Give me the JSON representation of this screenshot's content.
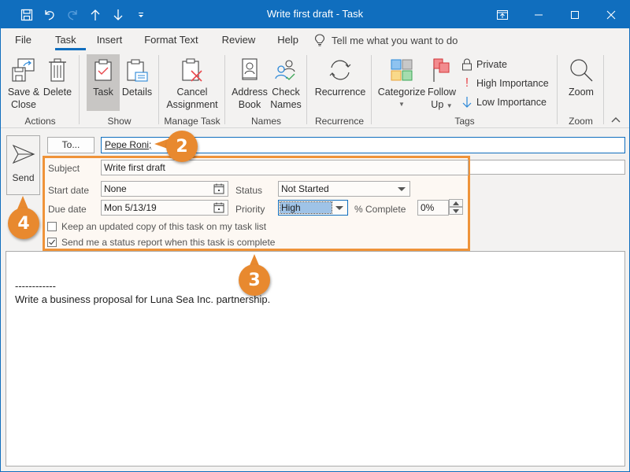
{
  "window": {
    "title": "Write first draft  -  Task",
    "accent_color": "#106ebe",
    "quick_access": [
      {
        "icon": "save-icon",
        "label": "Save"
      },
      {
        "icon": "undo-icon",
        "label": "Undo"
      },
      {
        "icon": "redo-icon",
        "label": "Redo"
      },
      {
        "icon": "arrow-up-icon",
        "label": "Previous Item"
      },
      {
        "icon": "arrow-down-icon",
        "label": "Next Item"
      },
      {
        "icon": "customize-qat-icon",
        "label": "Customize Quick Access Toolbar"
      }
    ],
    "controls": [
      "ribbon-display-options",
      "minimize",
      "maximize",
      "close"
    ]
  },
  "tabs": [
    {
      "label": "File",
      "active": false
    },
    {
      "label": "Task",
      "active": true
    },
    {
      "label": "Insert",
      "active": false
    },
    {
      "label": "Format Text",
      "active": false
    },
    {
      "label": "Review",
      "active": false
    },
    {
      "label": "Help",
      "active": false
    }
  ],
  "tell_me": {
    "placeholder": "Tell me what you want to do",
    "icon": "lightbulb-icon"
  },
  "ribbon": {
    "groups": {
      "actions": {
        "label": "Actions",
        "save_close": "Save &\nClose",
        "save_close_l1": "Save &",
        "save_close_l2": "Close",
        "delete": "Delete"
      },
      "show": {
        "label": "Show",
        "task": "Task",
        "details": "Details"
      },
      "manage_task": {
        "label": "Manage Task",
        "cancel_l1": "Cancel",
        "cancel_l2": "Assignment"
      },
      "names": {
        "label": "Names",
        "address_l1": "Address",
        "address_l2": "Book",
        "check_l1": "Check",
        "check_l2": "Names"
      },
      "recurrence": {
        "label": "Recurrence",
        "recurrence": "Recurrence"
      },
      "tags": {
        "label": "Tags",
        "categorize": "Categorize",
        "follow_l1": "Follow",
        "follow_l2": "Up",
        "private": "Private",
        "high": "High Importance",
        "low": "Low Importance"
      },
      "zoom": {
        "label": "Zoom",
        "zoom": "Zoom"
      }
    }
  },
  "form": {
    "send_label": "Send",
    "to_button": "To...",
    "to_value": "Pepe Roni;",
    "subject_label": "Subject",
    "subject_value": "Write first draft",
    "start_date_label": "Start date",
    "start_date_value": "None",
    "due_date_label": "Due date",
    "due_date_value": "Mon 5/13/19",
    "status_label": "Status",
    "status_value": "Not Started",
    "priority_label": "Priority",
    "priority_value": "High",
    "percent_label": "% Complete",
    "percent_value": "0%",
    "keep_copy_label": "Keep an updated copy of this task on my task list",
    "keep_copy_checked": false,
    "status_report_label": "Send me a status report when this task is complete",
    "status_report_checked": true
  },
  "body": {
    "line1": "------------",
    "line2": "Write a business proposal for Luna Sea Inc. partnership."
  },
  "callouts": {
    "c2": "2",
    "c3": "3",
    "c4": "4",
    "color": "#e8892f"
  }
}
